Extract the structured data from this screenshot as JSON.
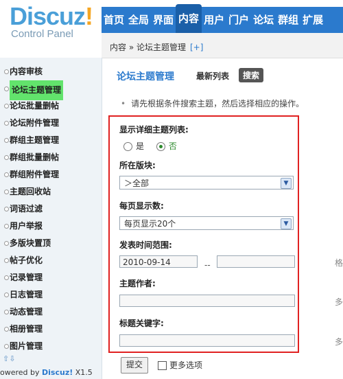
{
  "logo": {
    "name": "Discuz",
    "mark": "!",
    "subtitle": "Control Panel"
  },
  "nav": {
    "tabs": [
      "首页",
      "全局",
      "界面",
      "内容",
      "用户",
      "门户",
      "论坛",
      "群组",
      "扩展"
    ],
    "active": "内容"
  },
  "breadcrumb": {
    "text": "内容 » 论坛主题管理",
    "plus": "[+]"
  },
  "sidebar": {
    "items": [
      "内容审核",
      "论坛主题管理",
      "论坛批量删帖",
      "论坛附件管理",
      "群组主题管理",
      "群组批量删帖",
      "群组附件管理",
      "主题回收站",
      "词语过滤",
      "用户举报",
      "多版块置顶",
      "帖子优化",
      "记录管理",
      "日志管理",
      "动态管理",
      "相册管理",
      "图片管理"
    ],
    "active": "论坛主题管理",
    "arrows": "⇧⇩",
    "powered_prefix": "owered by",
    "powered_brand": "Discuz!",
    "powered_version": "X1.5"
  },
  "main": {
    "title": "论坛主题管理",
    "subtab_latest": "最新列表",
    "subtab_search": "搜索",
    "tip": "请先根据条件搜索主题，然后选择相应的操作。"
  },
  "form": {
    "detail_label": "显示详细主题列表:",
    "detail_yes": "是",
    "detail_no": "否",
    "forum_label": "所在版块:",
    "forum_value": "＞全部",
    "perpage_label": "每页显示数:",
    "perpage_value": "每页显示20个",
    "time_label": "发表时间范围:",
    "time_start": "2010-09-14",
    "time_sep": "--",
    "time_end": "",
    "author_label": "主题作者:",
    "author_value": "",
    "keyword_label": "标题关键字:",
    "keyword_value": "",
    "hint_time": "格",
    "hint_author": "多",
    "hint_keyword": "多"
  },
  "actions": {
    "submit": "提交",
    "more_options": "更多选项"
  }
}
